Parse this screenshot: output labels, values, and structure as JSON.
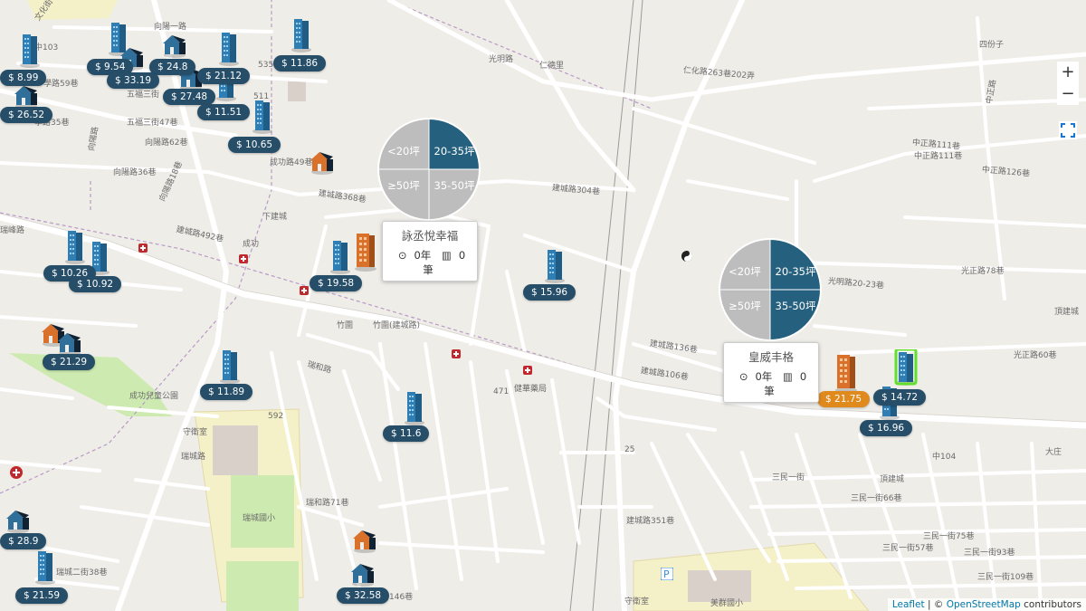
{
  "map": {
    "zoom_in": "+",
    "zoom_out": "−",
    "attribution": {
      "leaflet": "Leaflet",
      "sep": " | © ",
      "osm": "OpenStreetMap",
      "suffix": " contributors"
    }
  },
  "streets": [
    {
      "text": "文化街"
    },
    {
      "text": "中103"
    },
    {
      "text": "向陽一路"
    },
    {
      "text": "學路59巷"
    },
    {
      "text": "學路35巷"
    },
    {
      "text": "五福三街"
    },
    {
      "text": "五福三街47巷"
    },
    {
      "text": "向陽路62巷"
    },
    {
      "text": "向陽路36巷"
    },
    {
      "text": "向陽路18巷"
    },
    {
      "text": "成功路49巷"
    },
    {
      "text": "建城路492巷"
    },
    {
      "text": "建城路368巷"
    },
    {
      "text": "建城路304巷"
    },
    {
      "text": "光明路"
    },
    {
      "text": "仁化路263巷202弄"
    },
    {
      "text": "四份子"
    },
    {
      "text": "中正路111巷"
    },
    {
      "text": "中正路126巷"
    },
    {
      "text": "中正路111巷"
    },
    {
      "text": "光明路20-23巷"
    },
    {
      "text": "光正路78巷"
    },
    {
      "text": "頂建城"
    },
    {
      "text": "光正路60巷"
    },
    {
      "text": "建城路136巷"
    },
    {
      "text": "建城路106巷"
    },
    {
      "text": "瑞和路"
    },
    {
      "text": "成功兒童公園"
    },
    {
      "text": "守衛室"
    },
    {
      "text": "瑞城國小"
    },
    {
      "text": "三民一街66巷"
    },
    {
      "text": "三民一街57巷"
    },
    {
      "text": "三民一街75巷"
    },
    {
      "text": "三民一街93巷"
    },
    {
      "text": "三民一街109巷"
    },
    {
      "text": "美群國小"
    },
    {
      "text": "守衛室"
    },
    {
      "text": "健華藥局"
    },
    {
      "text": "中104"
    },
    {
      "text": "大庄"
    },
    {
      "text": "頂建城"
    },
    {
      "text": "建城路351巷"
    },
    {
      "text": "瑞城二街38巷"
    },
    {
      "text": "瑞和路146巷"
    },
    {
      "text": "瑞城路"
    },
    {
      "text": "瑞和路71巷"
    },
    {
      "text": "竹圍"
    },
    {
      "text": "竹圍(建城路)"
    },
    {
      "text": "成功"
    },
    {
      "text": "下建城"
    },
    {
      "text": "瑞峰路"
    },
    {
      "text": "471"
    },
    {
      "text": "25"
    },
    {
      "text": "592"
    },
    {
      "text": "仁德里"
    },
    {
      "text": "三民一街"
    },
    {
      "text": "中正路"
    },
    {
      "text": "向陽路"
    },
    {
      "text": "511"
    },
    {
      "text": "535"
    }
  ],
  "prices": [
    {
      "label": "$ 8.99"
    },
    {
      "label": "$ 9.54"
    },
    {
      "label": "$ 24.8"
    },
    {
      "label": "$ 33.19"
    },
    {
      "label": "$ 21.12"
    },
    {
      "label": "$ 11.86"
    },
    {
      "label": "$ 27.48"
    },
    {
      "label": "$ 26.52"
    },
    {
      "label": "$ 11.51"
    },
    {
      "label": "$ 10.65"
    },
    {
      "label": "$ 10.26"
    },
    {
      "label": "$ 10.92"
    },
    {
      "label": "$ 19.58"
    },
    {
      "label": "$ 15.96"
    },
    {
      "label": "$ 21.29"
    },
    {
      "label": "$ 11.89"
    },
    {
      "label": "$ 11.6"
    },
    {
      "label": "$ 21.75"
    },
    {
      "label": "$ 14.72"
    },
    {
      "label": "$ 16.96"
    },
    {
      "label": "$ 28.9"
    },
    {
      "label": "$ 21.59"
    },
    {
      "label": "$ 32.58"
    }
  ],
  "clusters": [
    {
      "segments": [
        "<20坪",
        "20-35坪",
        "≥50坪",
        "35-50坪"
      ],
      "title": "詠丞悅幸福",
      "years": "0年",
      "count": "0筆"
    },
    {
      "segments": [
        "<20坪",
        "20-35坪",
        "≥50坪",
        "35-50坪"
      ],
      "title": "皇威丰格",
      "years": "0年",
      "count": "0筆"
    }
  ],
  "colors": {
    "road": "#ffffff",
    "land": "#efede8",
    "park": "#cdebb0",
    "school": "#f4f0c8",
    "tower": "#2f7fb4",
    "price": "#264e68",
    "accent": "#e08a1e",
    "pie_dark": "#25607f",
    "pie_light": "#bdbdbd"
  }
}
